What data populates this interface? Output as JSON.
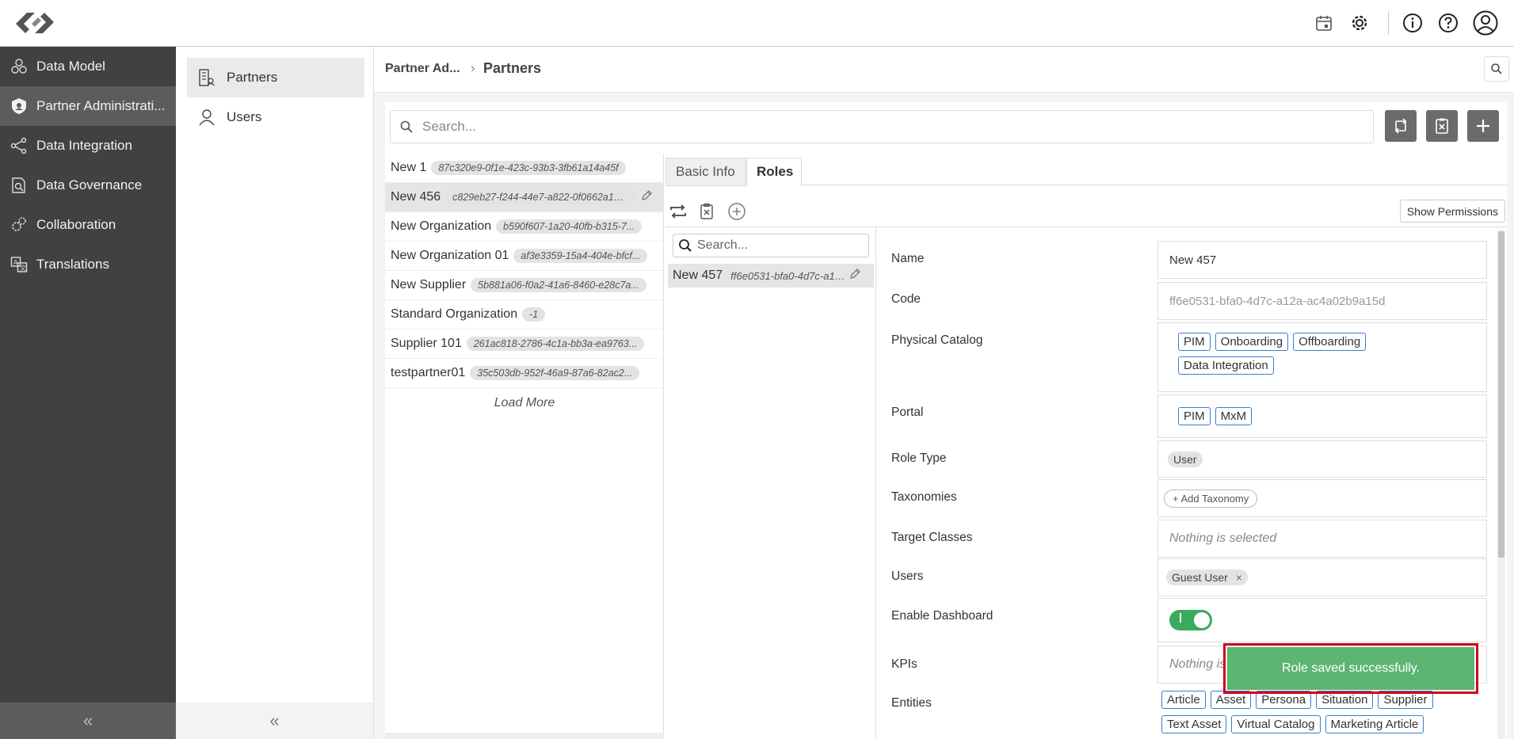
{
  "nav": {
    "items": [
      {
        "label": "Data Model",
        "icon": "cubes-icon"
      },
      {
        "label": "Partner Administrati...",
        "icon": "shield-icon"
      },
      {
        "label": "Data Integration",
        "icon": "share-nodes-icon"
      },
      {
        "label": "Data Governance",
        "icon": "governance-icon"
      },
      {
        "label": "Collaboration",
        "icon": "gears-icon"
      },
      {
        "label": "Translations",
        "icon": "translate-icon"
      }
    ],
    "collapse_label": "«"
  },
  "subnav": {
    "items": [
      {
        "label": "Partners",
        "icon": "building-icon"
      },
      {
        "label": "Users",
        "icon": "user-icon"
      }
    ],
    "collapse_label": "«"
  },
  "breadcrumb": {
    "parent": "Partner Ad...",
    "separator": "›",
    "current": "Partners"
  },
  "search": {
    "placeholder": "Search..."
  },
  "organizations": [
    {
      "name": "New 1",
      "id": "87c320e9-0f1e-423c-93b3-3fb61a14a45f"
    },
    {
      "name": "New 456",
      "id": "c829eb27-f244-44e7-a822-0f0662a1b51..."
    },
    {
      "name": "New Organization",
      "id": "b590f607-1a20-40fb-b315-7..."
    },
    {
      "name": "New Organization 01",
      "id": "af3e3359-15a4-404e-bfcf..."
    },
    {
      "name": "New Supplier",
      "id": "5b881a06-f0a2-41a6-8460-e28c7a..."
    },
    {
      "name": "Standard Organization",
      "id": "-1"
    },
    {
      "name": "Supplier 101",
      "id": "261ac818-2786-4c1a-bb3a-ea9763..."
    },
    {
      "name": "testpartner01",
      "id": "35c503db-952f-46a9-87a6-82ac2..."
    }
  ],
  "load_more": "Load More",
  "tabs": {
    "basic_info": "Basic Info",
    "roles": "Roles"
  },
  "show_permissions": "Show Permissions",
  "roles_search_placeholder": "Search...",
  "role": {
    "name": "New 457",
    "id": "ff6e0531-bfa0-4d7c-a12..."
  },
  "form": {
    "name": {
      "label": "Name",
      "value": "New 457"
    },
    "code": {
      "label": "Code",
      "value": "ff6e0531-bfa0-4d7c-a12a-ac4a02b9a15d"
    },
    "physical_catalog": {
      "label": "Physical Catalog",
      "tags": [
        "PIM",
        "Onboarding",
        "Offboarding",
        "Data Integration"
      ]
    },
    "portal": {
      "label": "Portal",
      "tags": [
        "PIM",
        "MxM"
      ]
    },
    "role_type": {
      "label": "Role Type",
      "value": "User"
    },
    "taxonomies": {
      "label": "Taxonomies",
      "button": "Add Taxonomy"
    },
    "target_classes": {
      "label": "Target Classes",
      "placeholder": "Nothing is selected"
    },
    "users": {
      "label": "Users",
      "value": "Guest User"
    },
    "enable_dashboard": {
      "label": "Enable Dashboard",
      "enabled": true
    },
    "kpis": {
      "label": "KPIs",
      "placeholder": "Nothing is"
    },
    "entities": {
      "label": "Entities",
      "tags": [
        "Article",
        "Asset",
        "Persona",
        "Situation",
        "Supplier",
        "Text Asset",
        "Virtual Catalog",
        "Marketing Article"
      ]
    }
  },
  "toast": {
    "message": "Role saved successfully."
  },
  "colors": {
    "sidebar": "#414141",
    "accent_tag": "#3a7bd5",
    "toast": "#5cb572",
    "toggle": "#3aaa5c",
    "highlight": "#d0021b"
  }
}
